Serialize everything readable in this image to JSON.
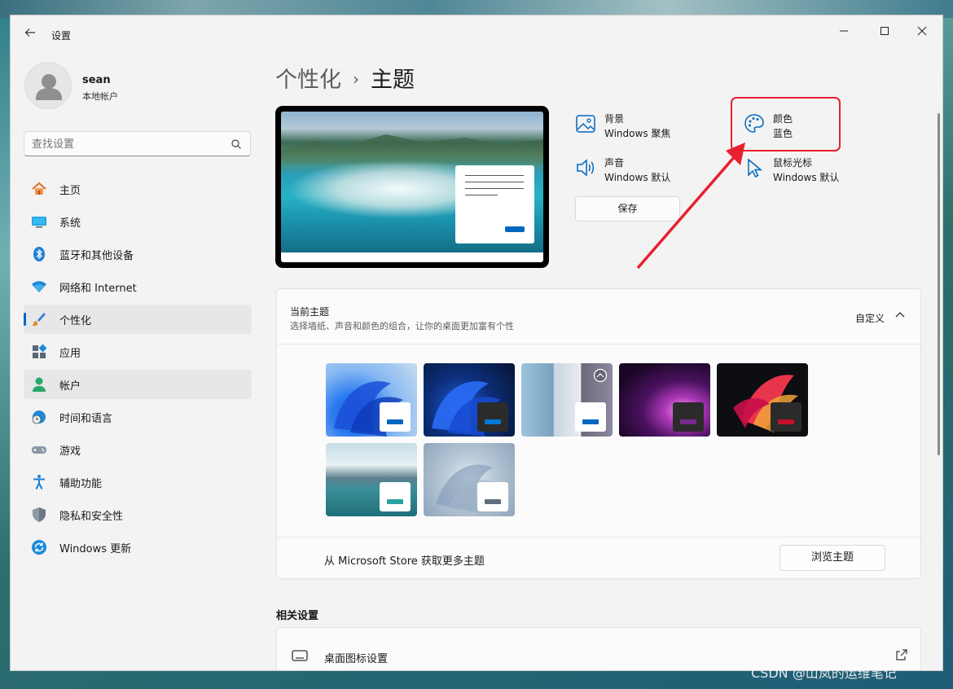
{
  "window": {
    "app_title": "设置",
    "controls": {
      "minimize": "—",
      "maximize": "☐",
      "close": "✕"
    }
  },
  "profile": {
    "name": "sean",
    "account_type": "本地帐户"
  },
  "search": {
    "placeholder": "查找设置"
  },
  "sidebar": {
    "items": [
      {
        "label": "主页",
        "icon": "home-icon"
      },
      {
        "label": "系统",
        "icon": "monitor-icon"
      },
      {
        "label": "蓝牙和其他设备",
        "icon": "bluetooth-icon"
      },
      {
        "label": "网络和 Internet",
        "icon": "wifi-icon"
      },
      {
        "label": "个性化",
        "icon": "brush-icon",
        "selected": true
      },
      {
        "label": "应用",
        "icon": "apps-icon"
      },
      {
        "label": "帐户",
        "icon": "account-icon",
        "hover": true
      },
      {
        "label": "时间和语言",
        "icon": "clock-globe-icon"
      },
      {
        "label": "游戏",
        "icon": "gamepad-icon"
      },
      {
        "label": "辅助功能",
        "icon": "accessibility-icon"
      },
      {
        "label": "隐私和安全性",
        "icon": "shield-icon"
      },
      {
        "label": "Windows 更新",
        "icon": "update-icon"
      }
    ]
  },
  "breadcrumb": {
    "parent": "个性化",
    "separator": "›",
    "current": "主题"
  },
  "theme_props": {
    "background": {
      "title": "背景",
      "value": "Windows 聚焦"
    },
    "color": {
      "title": "颜色",
      "value": "蓝色"
    },
    "sound": {
      "title": "声音",
      "value": "Windows 默认"
    },
    "cursor": {
      "title": "鼠标光标",
      "value": "Windows 默认"
    },
    "save_label": "保存"
  },
  "current_theme": {
    "title": "当前主题",
    "subtitle": "选择墙纸、声音和颜色的组合，让你的桌面更加富有个性",
    "status": "自定义",
    "themes": [
      {
        "name": "windows-light",
        "accent": "#0067c0",
        "window": "#ffffff"
      },
      {
        "name": "windows-dark",
        "accent": "#0078d4",
        "window": "#2b2b2b"
      },
      {
        "name": "spotlight",
        "accent": "#0067c0",
        "window": "#ffffff"
      },
      {
        "name": "glow",
        "accent": "#7a2a8c",
        "window": "#2b2b2b"
      },
      {
        "name": "captured-motion",
        "accent": "#c4102a",
        "window": "#2b2b2b"
      },
      {
        "name": "sunrise",
        "accent": "#2aa3a3",
        "window": "#ffffff"
      },
      {
        "name": "flow",
        "accent": "#5e6e7e",
        "window": "#ffffff"
      }
    ],
    "footer_text": "从 Microsoft Store 获取更多主题",
    "browse_label": "浏览主题"
  },
  "related": {
    "title": "相关设置",
    "items": [
      {
        "label": "桌面图标设置",
        "icon": "desktop-icon"
      }
    ]
  },
  "colors": {
    "accent": "#0067c0",
    "highlight": "#e8202e"
  },
  "watermark": "CSDN @山岚的运维笔记"
}
